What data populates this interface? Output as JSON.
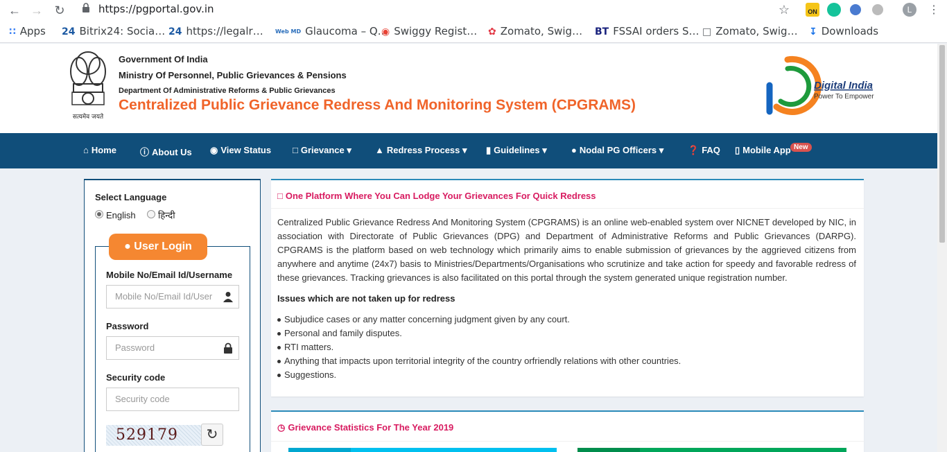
{
  "browser": {
    "url": "https://pgportal.gov.in",
    "bookmarks": [
      {
        "label": "Apps",
        "icon": "apps-grid-icon"
      },
      {
        "label": "Bitrix24: Socia…",
        "icon": "bitrix24-icon",
        "prefix": "24"
      },
      {
        "label": "https://legalr…",
        "icon": "bitrix24-icon",
        "prefix": "24"
      },
      {
        "label": "Glaucoma – Q…",
        "icon": "webmd-icon",
        "prefix": "Web MD"
      },
      {
        "label": "Swiggy Regist…",
        "icon": "chrome-icon"
      },
      {
        "label": "Zomato, Swig…",
        "icon": "zomato-icon"
      },
      {
        "label": "FSSAI orders S…",
        "icon": "bt-icon",
        "prefix": "BT"
      },
      {
        "label": "Zomato, Swig…",
        "icon": "document-icon"
      },
      {
        "label": "Downloads",
        "icon": "download-icon"
      }
    ],
    "profile_initial": "L",
    "ext_on_label": "ON"
  },
  "header": {
    "gov": "Government Of India",
    "ministry": "Ministry Of Personnel, Public Grievances & Pensions",
    "department": "Department Of Administrative Reforms & Public Grievances",
    "title": "Centralized Public Grievance Redress And Monitoring System (CPGRAMS)",
    "emblem_motto": "सत्यमेव जयते",
    "di_title": "Digital India",
    "di_tagline": "Power To Empower"
  },
  "nav": {
    "items": [
      {
        "label": "Home",
        "icon": "home-icon"
      },
      {
        "label": "About Us",
        "icon": "info-icon"
      },
      {
        "label": "View Status",
        "icon": "eye-icon"
      },
      {
        "label": "Grievance",
        "icon": "file-icon",
        "dropdown": true
      },
      {
        "label": "Redress Process",
        "icon": "sitemap-icon",
        "dropdown": true
      },
      {
        "label": "Guidelines",
        "icon": "book-icon",
        "dropdown": true
      },
      {
        "label": "Nodal PG Officers",
        "icon": "users-icon",
        "dropdown": true
      },
      {
        "label": "FAQ",
        "icon": "question-icon"
      },
      {
        "label": "Mobile App",
        "icon": "mobile-icon"
      }
    ],
    "new_badge": "New"
  },
  "login": {
    "select_language": "Select Language",
    "lang_english": "English",
    "lang_hindi": "हिन्दी",
    "selected_language": "English",
    "button": "User Login",
    "mobile_label": "Mobile No/Email Id/Username",
    "mobile_placeholder": "Mobile No/Email Id/Username",
    "password_label": "Password",
    "password_placeholder": "Password",
    "security_label": "Security code",
    "security_placeholder": "Security code",
    "captcha": "529179"
  },
  "about": {
    "heading": "One Platform Where You Can Lodge Your Grievances For Quick Redress",
    "intro": "Centralized Public Grievance Redress And Monitoring System (CPGRAMS) is an online web-enabled system over NICNET developed by NIC, in association with Directorate of Public Grievances (DPG) and Department of Administrative Reforms and Public Grievances (DARPG). CPGRAMS is the platform based on web technology which primarily aims to enable submission of grievances by the aggrieved citizens from anywhere and anytime (24x7) basis to Ministries/Departments/Organisations who scrutinize and take action for speedy and favorable redress of these grievances. Tracking grievances is also facilitated on this portal through the system generated unique registration number.",
    "issues_heading": "Issues which are not taken up for redress",
    "issues": [
      "Subjudice cases or any matter concerning judgment given by any court.",
      "Personal and family disputes.",
      "RTI matters.",
      "Anything that impacts upon territorial integrity of the country orfriendly relations with other countries.",
      "Suggestions."
    ]
  },
  "stats": {
    "heading": "Grievance Statistics For The Year 2019"
  },
  "colors": {
    "navbar": "#104e7a",
    "accent_orange": "#f0642a",
    "heading_pink": "#d81b60"
  }
}
